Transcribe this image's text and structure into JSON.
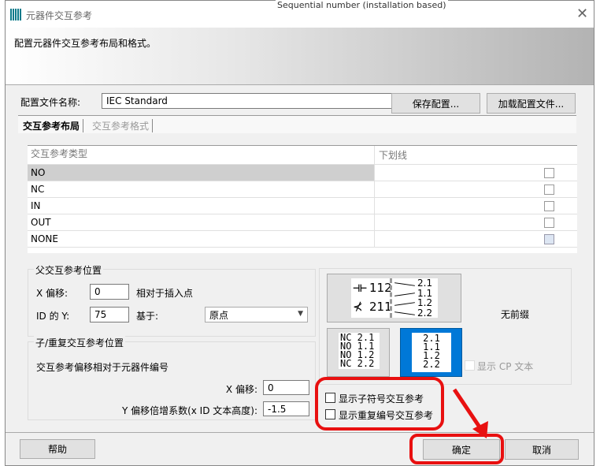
{
  "window": {
    "title": "元器件交互参考",
    "description": "配置元器件交互参考布局和格式。",
    "background_text": "Sequential number (installation based)"
  },
  "profile": {
    "label": "配置文件名称:",
    "value": "IEC Standard",
    "save_label": "保存配置...",
    "load_label": "加载配置文件..."
  },
  "tabs": [
    {
      "label": "交互参考布局",
      "active": true
    },
    {
      "label": "交互参考格式",
      "active": false
    }
  ],
  "table": {
    "headers": [
      "交互参考类型",
      "下划线"
    ],
    "rows": [
      {
        "type": "NO",
        "underline": false,
        "selected": true
      },
      {
        "type": "NC",
        "underline": false
      },
      {
        "type": "IN",
        "underline": false
      },
      {
        "type": "OUT",
        "underline": false
      },
      {
        "type": "NONE",
        "underline": false
      }
    ]
  },
  "parent": {
    "title": "父交互参考位置",
    "x_label": "X 偏移:",
    "x_value": "0",
    "relative_label": "相对于插入点",
    "y_label": "ID 的 Y:",
    "y_value": "75",
    "base_label": "基于:",
    "base_value": "原点"
  },
  "child": {
    "title": "子/重复交互参考位置",
    "desc": "交互参考偏移相对于元器件编号",
    "x_label": "X 偏移:",
    "x_value": "0",
    "y_label": "Y 偏移倍增系数(x ID 文本高度):",
    "y_value": "-1.5"
  },
  "preview": {
    "symbols": [
      "112",
      "211"
    ],
    "contacts": [
      "2.1",
      "1.1",
      "1.2",
      "2.2"
    ],
    "prefixed": [
      "NC 2.1",
      "NO 1.1",
      "NO 1.2",
      "NC 2.2"
    ],
    "plain": [
      "2.1",
      "1.1",
      "1.2",
      "2.2"
    ],
    "no_prefix_label": "无前缀",
    "show_cp_label": "显示 CP 文本"
  },
  "options": {
    "show_child_label": "显示子符号交互参考",
    "show_dup_label": "显示重复编号交互参考"
  },
  "footer": {
    "help_label": "帮助",
    "ok_label": "确定",
    "cancel_label": "取消"
  },
  "colors": {
    "highlight": "#e81010",
    "selected": "#0078d7"
  }
}
